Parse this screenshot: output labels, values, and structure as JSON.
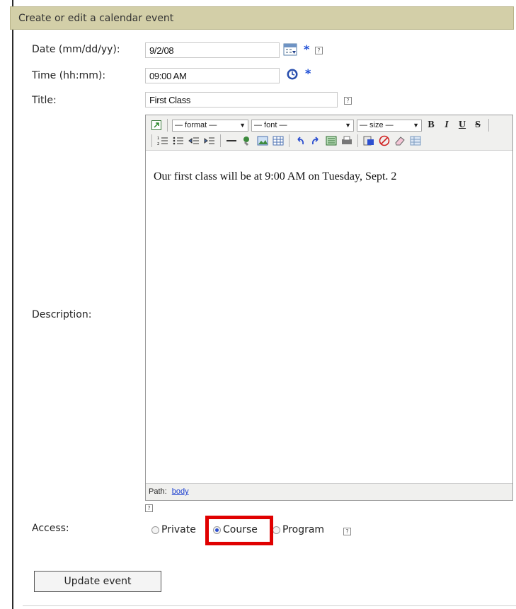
{
  "header": {
    "title": "Create or edit a calendar event"
  },
  "form": {
    "date_label": "Date (mm/dd/yy):",
    "date_value": "9/2/08",
    "time_label": "Time (hh:mm):",
    "time_value": "09:00 AM",
    "title_label": "Title:",
    "title_value": "First Class",
    "description_label": "Description:",
    "required_mark": "*",
    "help_mark": "?"
  },
  "editor": {
    "format_select": "— format —",
    "font_select": "— font —",
    "size_select": "— size —",
    "bold": "B",
    "italic": "I",
    "underline": "U",
    "strike": "S",
    "content": "Our first class will be at 9:00 AM on Tuesday, Sept. 2",
    "path_label": "Path:",
    "path_link": "body"
  },
  "access": {
    "label": "Access:",
    "options": [
      {
        "label": "Private",
        "selected": false
      },
      {
        "label": "Course",
        "selected": true
      },
      {
        "label": "Program",
        "selected": false
      }
    ]
  },
  "actions": {
    "update_label": "Update event"
  },
  "colors": {
    "header_bg": "#d3cfa8",
    "accent_blue": "#1f4fd6",
    "highlight_red": "#e00000"
  }
}
